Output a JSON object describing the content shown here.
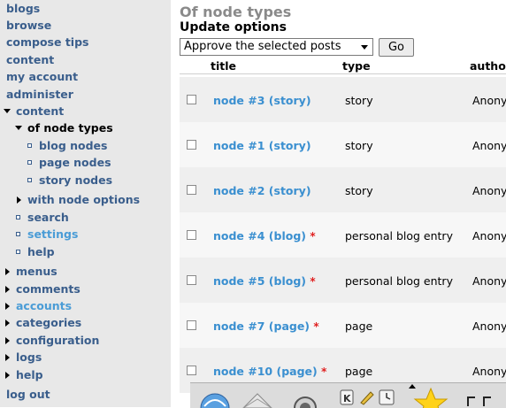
{
  "sidebar": {
    "items": [
      {
        "label": "blogs"
      },
      {
        "label": "browse"
      },
      {
        "label": "compose tips"
      },
      {
        "label": "content"
      },
      {
        "label": "my account"
      },
      {
        "label": "administer"
      },
      {
        "label": "content"
      },
      {
        "label": "of node types"
      },
      {
        "label": "blog nodes"
      },
      {
        "label": "page nodes"
      },
      {
        "label": "story nodes"
      },
      {
        "label": "with node options"
      },
      {
        "label": "search"
      },
      {
        "label": "settings"
      },
      {
        "label": "help"
      },
      {
        "label": "menus"
      },
      {
        "label": "comments"
      },
      {
        "label": "accounts"
      },
      {
        "label": "categories"
      },
      {
        "label": "configuration"
      },
      {
        "label": "logs"
      },
      {
        "label": "help"
      },
      {
        "label": "log out"
      }
    ]
  },
  "main": {
    "title": "Of node types",
    "update_heading": "Update options",
    "operation_selected": "Approve the selected posts",
    "go_label": "Go",
    "columns": [
      "title",
      "type",
      "author"
    ],
    "rows": [
      {
        "title": "node #3 (story)",
        "new": false,
        "type": "story",
        "author": "Anony"
      },
      {
        "title": "node #1 (story)",
        "new": false,
        "type": "story",
        "author": "Anony"
      },
      {
        "title": "node #2 (story)",
        "new": false,
        "type": "story",
        "author": "Anony"
      },
      {
        "title": "node #4 (blog)",
        "new": true,
        "type": "personal blog entry",
        "author": "Anony"
      },
      {
        "title": "node #5 (blog)",
        "new": true,
        "type": "personal blog entry",
        "author": "Anony"
      },
      {
        "title": "node #7 (page)",
        "new": true,
        "type": "page",
        "author": "Anony"
      },
      {
        "title": "node #10 (page)",
        "new": true,
        "type": "page",
        "author": "Anony"
      }
    ],
    "new_marker": "*"
  },
  "taskbar": {
    "icons": [
      "browser-icon",
      "mail-icon",
      "sound-icon",
      "k-menu-icon",
      "pen-icon",
      "clock-icon",
      "star-icon"
    ]
  },
  "colors": {
    "link": "#3a5e8c",
    "link_light": "#4a9cd6",
    "title_link": "#3a8fd0",
    "marker": "#e02020",
    "sidebar_bg": "#e8e8e8"
  }
}
